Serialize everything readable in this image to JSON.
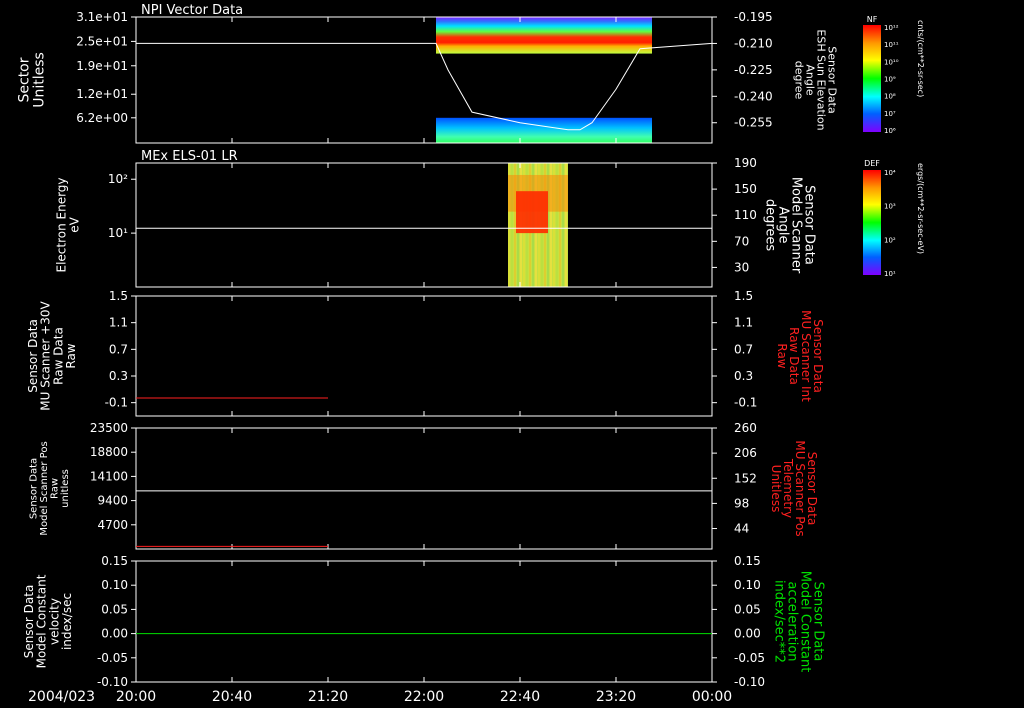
{
  "colors": {
    "background": "#000000",
    "axis": "#ffffff",
    "trace_white": "#ffffff",
    "trace_red": "#ff2020",
    "trace_green": "#00e000",
    "label_red": "#ff2020",
    "label_green": "#00e000"
  },
  "footer": {
    "date": "2004/023",
    "time_ticks": [
      "20:00",
      "20:40",
      "21:20",
      "22:00",
      "22:40",
      "23:20",
      "00:00"
    ]
  },
  "colorbars": [
    {
      "title": "NF",
      "ticks": [
        "10¹²",
        "10¹¹",
        "10¹⁰",
        "10⁹",
        "10⁸",
        "10⁷",
        "10⁶"
      ],
      "units": "cnts/(cm**2-sr-sec)"
    },
    {
      "title": "DEF",
      "ticks": [
        "10⁴",
        "10³",
        "10²",
        "10¹"
      ],
      "units": "ergs/(cm**2-sr-sec-eV)"
    }
  ],
  "chart_data": [
    {
      "type": "heatmap",
      "title": "NPI Vector Data",
      "ylabel": [
        "Sector",
        "Unitless"
      ],
      "yticks": [
        "3.1e+01",
        "2.5e+01",
        "1.9e+01",
        "1.2e+01",
        "6.2e+00"
      ],
      "ylim": [
        0,
        31
      ],
      "right_ylabel": [
        "Sensor Data",
        "ESH Sun Elevation",
        "Angle",
        "degree"
      ],
      "right_yticks": [
        "-0.195",
        "-0.210",
        "-0.225",
        "-0.240",
        "-0.255"
      ],
      "right_ylim": [
        -0.2665,
        -0.195
      ],
      "heatmap_blocks": [
        {
          "t_start": "22:05",
          "t_end": "23:35",
          "sector_range": [
            22,
            31
          ],
          "level": "high"
        },
        {
          "t_start": "22:05",
          "t_end": "23:35",
          "sector_range": [
            0,
            6.2
          ],
          "level": "low"
        }
      ],
      "line_series": {
        "color": "white",
        "axis": "right",
        "x": [
          "20:00",
          "22:05",
          "22:10",
          "22:20",
          "22:40",
          "23:00",
          "23:05",
          "23:10",
          "23:20",
          "23:30",
          "00:00"
        ],
        "y": [
          -0.21,
          -0.21,
          -0.225,
          -0.249,
          -0.255,
          -0.259,
          -0.259,
          -0.255,
          -0.236,
          -0.213,
          -0.21
        ]
      }
    },
    {
      "type": "heatmap",
      "title": "MEx ELS-01 LR",
      "ylabel": [
        "Electron Energy",
        "eV"
      ],
      "yscale": "log",
      "yticks": [
        "10²",
        "10¹"
      ],
      "ylim": [
        1,
        200
      ],
      "right_ylabel": [
        "Sensor Data",
        "Model Scanner",
        "Angle",
        "degrees"
      ],
      "right_yticks": [
        "190",
        "150",
        "110",
        "70",
        "30"
      ],
      "right_ylim": [
        0,
        190
      ],
      "heatmap_blocks": [
        {
          "t_start": "22:35",
          "t_end": "23:00",
          "energy_range": [
            1,
            200
          ],
          "level": "mid"
        },
        {
          "t_start": "22:35",
          "t_end": "23:00",
          "energy_range": [
            10,
            60
          ],
          "level": "high"
        }
      ],
      "line_series": {
        "color": "white",
        "axis": "right",
        "x": [
          "20:00",
          "00:00"
        ],
        "y": [
          90,
          90
        ]
      }
    },
    {
      "type": "line",
      "ylabel": [
        "Sensor Data",
        "MU Scanner +30V",
        "Raw Data",
        "Raw"
      ],
      "yticks": [
        "1.5",
        "1.1",
        "0.7",
        "0.3",
        "-0.1"
      ],
      "ylim": [
        -0.3,
        1.5
      ],
      "right_ylabel": [
        "Sensor Data",
        "MU Scanner Int",
        "Raw Data",
        "Raw"
      ],
      "right_yticks": [
        "1.5",
        "1.1",
        "0.7",
        "0.3",
        "-0.1"
      ],
      "series": [
        {
          "color": "red",
          "x": [
            "20:00",
            "21:20"
          ],
          "y": [
            -0.03,
            -0.03
          ]
        }
      ]
    },
    {
      "type": "line",
      "ylabel": [
        "Sensor Data",
        "Model Scanner Pos",
        "Raw",
        "unitless"
      ],
      "yticks": [
        "23500",
        "18800",
        "14100",
        "9400",
        "4700"
      ],
      "ylim": [
        0,
        23500
      ],
      "right_ylabel": [
        "Sensor Data",
        "MU Scanner Pos",
        "Telemetry",
        "Unitless"
      ],
      "right_yticks": [
        "260",
        "206",
        "152",
        "98",
        "44"
      ],
      "right_ylim": [
        0,
        260
      ],
      "series": [
        {
          "color": "white",
          "axis": "right",
          "x": [
            "20:00",
            "00:00"
          ],
          "y": [
            125,
            125
          ]
        },
        {
          "color": "red",
          "axis": "left",
          "x": [
            "20:00",
            "21:20"
          ],
          "y": [
            500,
            500
          ]
        }
      ]
    },
    {
      "type": "line",
      "ylabel": [
        "Sensor Data",
        "Model Constant",
        "velocity",
        "index/sec"
      ],
      "yticks": [
        "0.15",
        "0.10",
        "0.05",
        "0.00",
        "-0.05",
        "-0.10"
      ],
      "ylim": [
        -0.1,
        0.15
      ],
      "right_ylabel": [
        "Sensor Data",
        "Model Constant",
        "acceleration",
        "index/sec**2"
      ],
      "right_yticks": [
        "0.15",
        "0.10",
        "0.05",
        "0.00",
        "-0.05",
        "-0.10"
      ],
      "series": [
        {
          "color": "green",
          "x": [
            "20:00",
            "00:00"
          ],
          "y": [
            0,
            0
          ]
        }
      ]
    }
  ]
}
